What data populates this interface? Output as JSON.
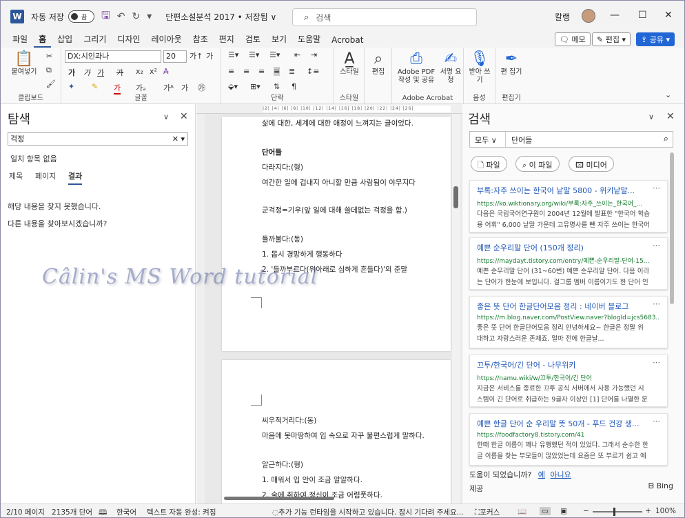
{
  "titlebar": {
    "logo": "W",
    "autosave_label": "자동 저장",
    "autosave_state": "끔",
    "doc_title": "단편소설분석 2017 • 저장됨 ∨",
    "search_placeholder": "검색",
    "user_name": "칼랭",
    "min": "—",
    "max": "☐",
    "close": "✕"
  },
  "menu": {
    "items": [
      "파일",
      "홈",
      "삽입",
      "그리기",
      "디자인",
      "레이아웃",
      "참조",
      "편지",
      "검토",
      "보기",
      "도움말",
      "Acrobat"
    ],
    "memo": "메모",
    "edit": "편집 ▾",
    "share": "공유 ▾"
  },
  "ribbon": {
    "paste": "붙여넣기",
    "clipboard": "클립보드",
    "font_name": "DXː시인과나",
    "font_size": "20",
    "font_group": "글꼴",
    "paragraph_group": "단락",
    "style": "스타일",
    "style_group": "스타일",
    "editing": "편집",
    "pdf": "Adobe PDF 작성 및 공유",
    "sign": "서명 요청",
    "acrobat_group": "Adobe Acrobat",
    "dictate": "받아 쓰기",
    "voice_group": "음성",
    "editor": "편 집기",
    "editor_group": "편집기"
  },
  "nav": {
    "title": "탐색",
    "search_value": "걱정",
    "no_match": "일치 항목 없음",
    "tabs": [
      "제목",
      "페이지",
      "결과"
    ],
    "not_found": "해당 내용을 찾지 못했습니다.",
    "other": "다른 내용을 찾아보시겠습니까?"
  },
  "document": {
    "page1": [
      "삶에 대한, 세계에 대한 애정이 느껴지는 글이었다.",
      "",
      "단어들",
      "다라지다:(형)",
      "여간한 일에 겁내지 아니할 만큼 사람됨이 야무지다",
      "",
      "군걱정=기우(앞 일에 대해 쓸데없는 걱정을 함.)",
      "",
      "들까불다:(동)",
      "1. 몹시 경망하게 행동하다",
      "2. '들까부르다(위아래로 심하게 흔들다)'의 준말"
    ],
    "page2": [
      "씨우적거리다:(동)",
      "마음에 못마땅하여 입 속으로 자꾸 불편스럽게 말하다.",
      "",
      "알근하다:(형)",
      "1. 매워서 입 안이 조금 알알하다.",
      "2. 술에 취하여 정신이 조금 어렴풋하다."
    ],
    "watermark": "Câlin's MS Word tutorial",
    "ruler_ticks": "|2| |4| |6| |8| |10| |12| |14| |16| |18| |20| |22| |24| |26|"
  },
  "search_pane": {
    "title": "검색",
    "filter": "모두 ∨",
    "query": "단어들",
    "chips": [
      "파일",
      "이 파일",
      "미디어"
    ],
    "results": [
      {
        "title": "부록:자주 쓰이는 한국어 낱말 5800 - 위키낱말...",
        "url": "https://ko.wiktionary.org/wiki/부록:자주_쓰이는_한국어_...",
        "s1": "다음은 국립국어연구원이 2004년 12월에 발표한 \"한국어 학습",
        "s2": "용 어휘\" 6,000 낱말 가운데 고유명사를 뺀 자주 쓰이는 한국어"
      },
      {
        "title": "예쁜 순우리말 단어 (150개 정리)",
        "url": "https://maydayt.tistory.com/entry/예쁜-순우리말-단어-15...",
        "s1": "예쁜 순우리말 단어 (31~60번) 예쁜 순우리말 단어. 다음 이라",
        "s2": "는 단어가 한눈에 보입니다. 걸그룹 멤버 이름이기도 한 단어 인"
      },
      {
        "title": "좋은 뜻 단어 한글단어모음 정리 : 네이버 블로그",
        "url": "https://m.blog.naver.com/PostView.naver?blogId=jcs5683...",
        "s1": "좋은 뜻 단어 한글단어모음 정리 안녕하세요~ 한글은 정말 위",
        "s2": "대하고 자랑스러운 존재죠. 얼마 전에 한글날..."
      },
      {
        "title": "끄투/한국어/긴 단어 - 나무위키",
        "url": "https://namu.wiki/w/끄투/한국어/긴 단어",
        "s1": "지금은 서비스를 종료한 끄투 공식 서버에서 사용 가능했던 시",
        "s2": "스템이 긴 단어로 취급하는 9글자 이상인 [1] 단어를 나열한 문"
      },
      {
        "title": "예쁜 한글 단어 순 우리말 뜻 50개 - 푸드 건강 생...",
        "url": "https://foodfactory8.tistory.com/41",
        "s1": "한때 한글 이름이 꽤나 유행했던 적이 있었다. 그래서 순수한 한",
        "s2": "글 이름을 찾는 부모들이 많았었는데 요즘은 또 부르기 쉽고 예"
      }
    ],
    "helpful": "도움이 되었습니까?",
    "yes": "예",
    "no": "아니요",
    "provider": "제공",
    "bing": "Bing"
  },
  "status": {
    "page": "2/10 페이지",
    "words": "2135개 단어",
    "lang": "한국어",
    "autocomplete": "텍스트 자동 완성: 켜짐",
    "message": "추가 기능 런타임을 시작하고 있습니다. 잠시 기다려 주세요...",
    "focus": "포커스",
    "zoom": "100%"
  }
}
